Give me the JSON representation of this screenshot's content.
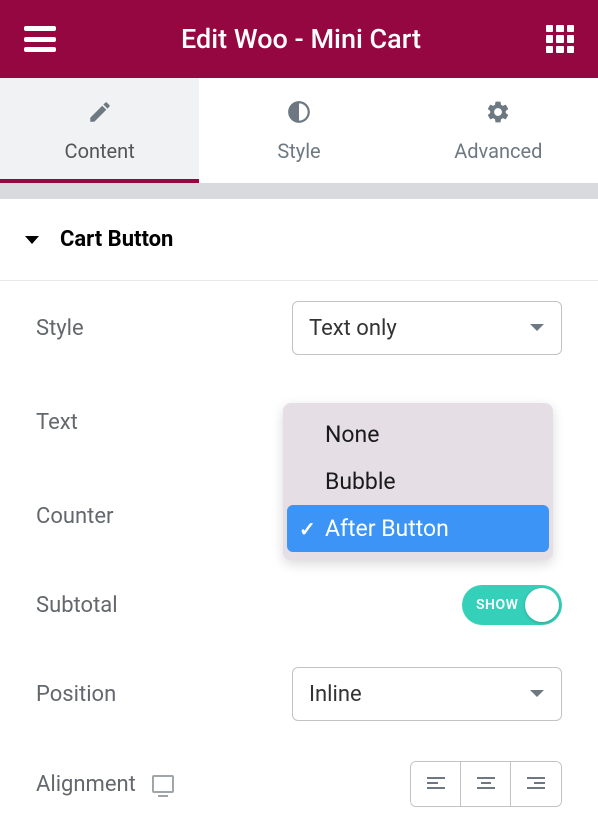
{
  "header": {
    "title": "Edit Woo - Mini Cart"
  },
  "tabs": {
    "content": "Content",
    "style": "Style",
    "advanced": "Advanced"
  },
  "section": {
    "title": "Cart Button"
  },
  "controls": {
    "style": {
      "label": "Style",
      "value": "Text only"
    },
    "text": {
      "label": "Text"
    },
    "counter": {
      "label": "Counter",
      "options": {
        "none": "None",
        "bubble": "Bubble",
        "after_button": "After Button"
      }
    },
    "subtotal": {
      "label": "Subtotal",
      "toggle": "SHOW"
    },
    "position": {
      "label": "Position",
      "value": "Inline"
    },
    "alignment": {
      "label": "Alignment"
    }
  }
}
